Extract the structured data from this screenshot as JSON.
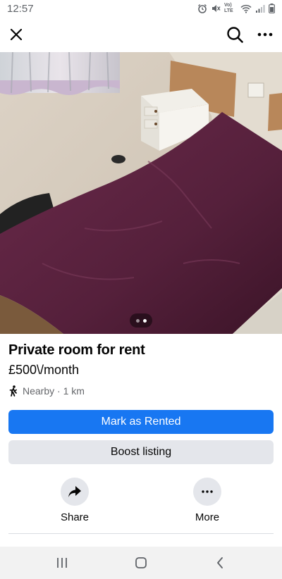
{
  "status_bar": {
    "time": "12:57",
    "network_label": "Vo) LTE",
    "icons": [
      "alarm-icon",
      "mute-icon",
      "wifi-icon",
      "signal-icon",
      "battery-icon"
    ]
  },
  "header": {
    "icons": [
      "close-icon",
      "search-icon",
      "more-horizontal-icon"
    ]
  },
  "photo": {
    "page_count": 2,
    "current_page": 2
  },
  "listing": {
    "title": "Private room for rent",
    "price": "£500\\/month",
    "location": "Nearby · 1 km"
  },
  "buttons": {
    "primary_label": "Mark as Rented",
    "secondary_label": "Boost listing"
  },
  "actions": {
    "share_label": "Share",
    "more_label": "More"
  },
  "nav_bar": {
    "icons": [
      "recent-apps-icon",
      "home-icon",
      "back-icon"
    ]
  },
  "colors": {
    "primary": "#1877f2",
    "secondary_bg": "#e4e6eb",
    "text": "#050505",
    "muted": "#65676b"
  }
}
